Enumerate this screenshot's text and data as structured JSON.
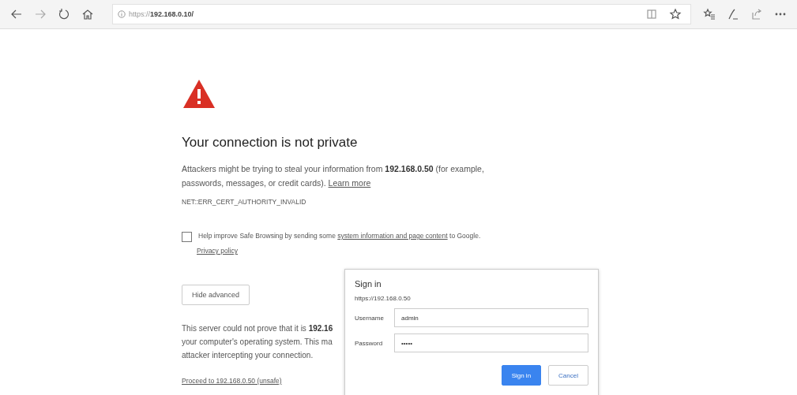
{
  "browser": {
    "address_scheme": "https://",
    "address_host": "192.168.0.10/"
  },
  "page": {
    "title": "Your connection is not private",
    "description": "Attackers might be trying to steal your information from **192.168.0.50** (for example, passwords, messages, or credit cards).",
    "learn_more": "Learn more",
    "error_code": "NET::ERR_CERT_AUTHORITY_INVALID",
    "safe_browsing": {
      "checked": false,
      "text_before": "Help improve Safe Browsing by sending some",
      "link": "system information and page content",
      "text_after": "to Google."
    },
    "privacy_link": "Privacy policy",
    "hide_advanced": "Hide advanced",
    "advanced_lines": [
      "This server could not prove that it is **192.16**",
      "your computer's operating system. This ma",
      "attacker intercepting your connection."
    ],
    "proceed_link": "Proceed to 192.168.0.50 (unsafe)"
  },
  "dialog": {
    "title": "Sign in",
    "origin": "https://192.168.0.50",
    "fields": [
      {
        "label": "Username",
        "value": "admin"
      },
      {
        "label": "Password",
        "value": "•••••"
      }
    ],
    "buttons": [
      {
        "label": "Sign in",
        "kind": "primary"
      },
      {
        "label": "Cancel",
        "kind": "secondary"
      }
    ]
  }
}
